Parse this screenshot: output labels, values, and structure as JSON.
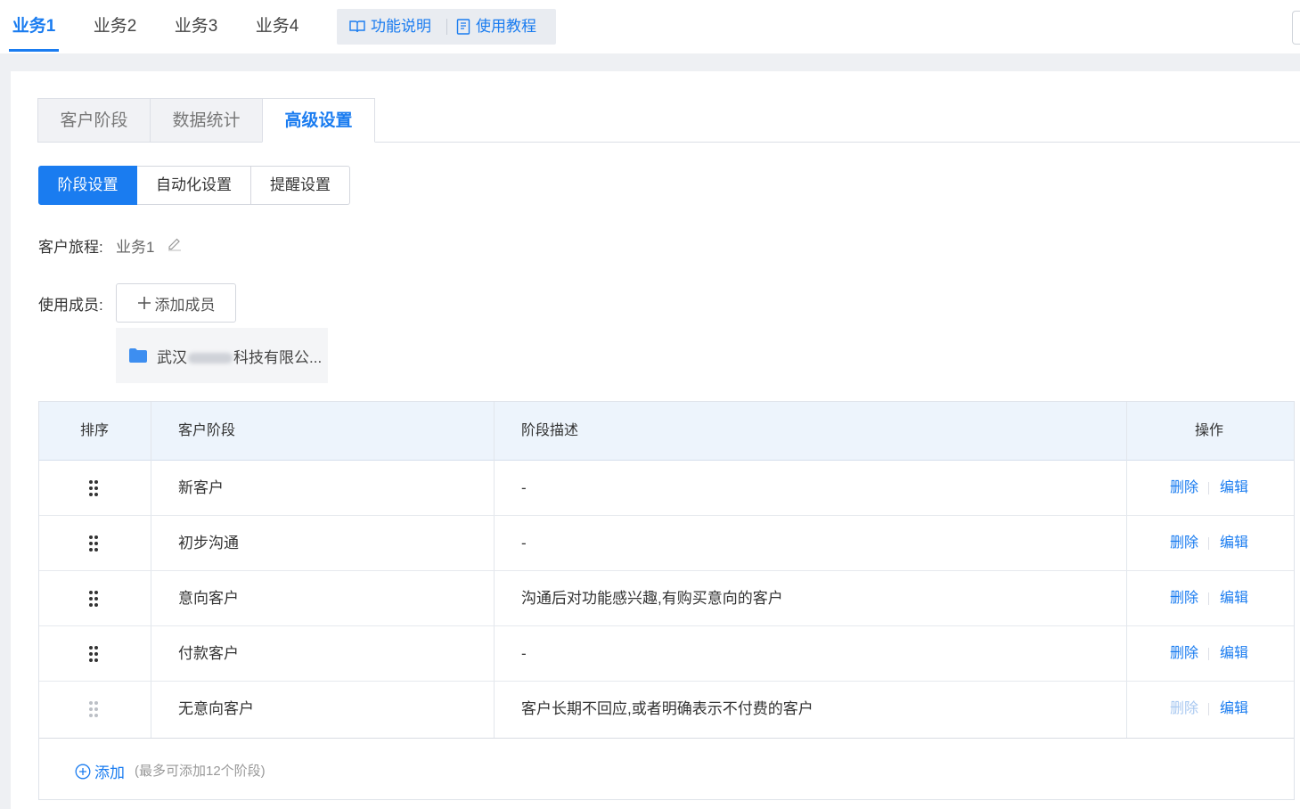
{
  "biz_tabs": [
    "业务1",
    "业务2",
    "业务3",
    "业务4"
  ],
  "help_links": {
    "feature": "功能说明",
    "tutorial": "使用教程"
  },
  "main_tabs": [
    "客户阶段",
    "数据统计",
    "高级设置"
  ],
  "sub_tabs": [
    "阶段设置",
    "自动化设置",
    "提醒设置"
  ],
  "journey": {
    "label": "客户旅程:",
    "value": "业务1"
  },
  "members": {
    "label": "使用成员:",
    "add_button": "添加成员",
    "org_prefix": "武汉",
    "org_suffix": "科技有限公..."
  },
  "table": {
    "headers": [
      "排序",
      "客户阶段",
      "阶段描述",
      "操作"
    ],
    "rows": [
      {
        "stage": "新客户",
        "desc": "-",
        "delete": "删除",
        "edit": "编辑"
      },
      {
        "stage": "初步沟通",
        "desc": "-",
        "delete": "删除",
        "edit": "编辑"
      },
      {
        "stage": "意向客户",
        "desc": "沟通后对功能感兴趣,有购买意向的客户",
        "delete": "删除",
        "edit": "编辑"
      },
      {
        "stage": "付款客户",
        "desc": "-",
        "delete": "删除",
        "edit": "编辑"
      },
      {
        "stage": "无意向客户",
        "desc": "客户长期不回应,或者明确表示不付费的客户",
        "delete": "删除",
        "edit": "编辑"
      }
    ],
    "add_label": "添加",
    "add_hint": "(最多可添加12个阶段)"
  },
  "colors": {
    "accent": "#1a7cf0",
    "header_bg": "#edf4fc",
    "folder": "#3d8ef0"
  }
}
